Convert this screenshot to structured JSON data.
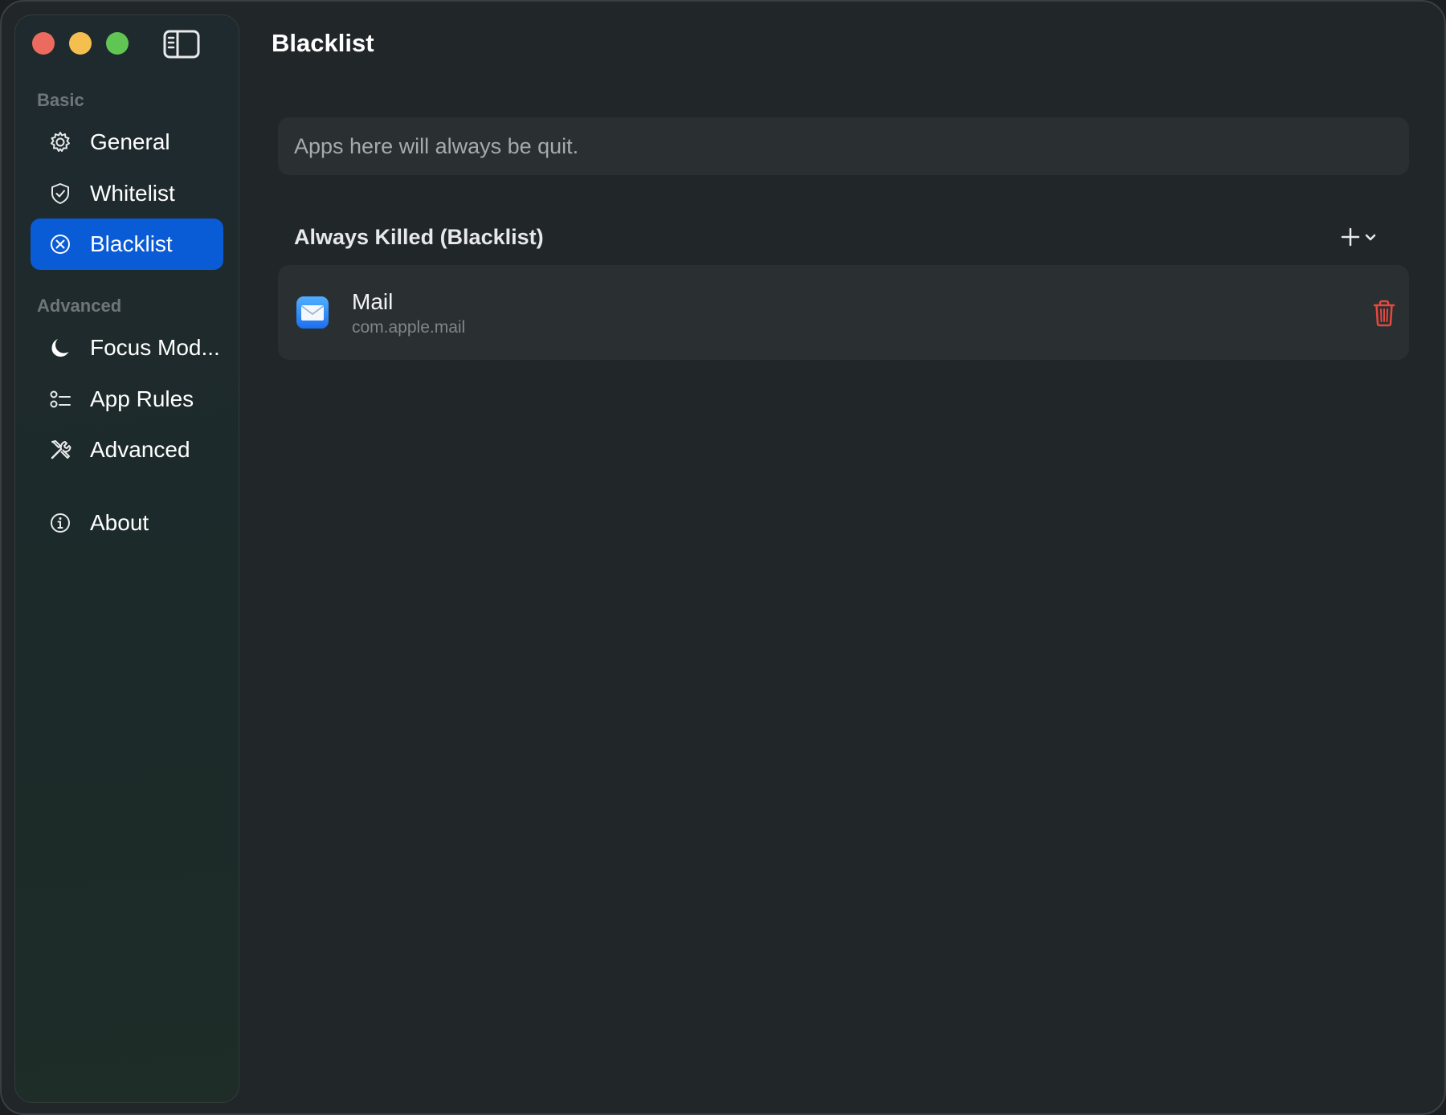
{
  "window": {
    "title": "Blacklist"
  },
  "sidebar": {
    "sections": [
      {
        "label": "Basic",
        "items": [
          {
            "label": "General",
            "icon": "gear-icon"
          },
          {
            "label": "Whitelist",
            "icon": "shield-check-icon"
          },
          {
            "label": "Blacklist",
            "icon": "x-circle-icon",
            "active": true
          }
        ]
      },
      {
        "label": "Advanced",
        "items": [
          {
            "label": "Focus Mod...",
            "icon": "moon-icon"
          },
          {
            "label": "App Rules",
            "icon": "checklist-icon"
          },
          {
            "label": "Advanced",
            "icon": "tools-icon"
          }
        ]
      }
    ],
    "footer_items": [
      {
        "label": "About",
        "icon": "info-circle-icon"
      }
    ]
  },
  "main": {
    "description": "Apps here will always be quit.",
    "section_title": "Always Killed (Blacklist)",
    "apps": [
      {
        "name": "Mail",
        "bundle_id": "com.apple.mail",
        "icon": "mail-app-icon"
      }
    ]
  },
  "colors": {
    "accent": "#0a5bd6",
    "delete": "#e5483f",
    "traffic_red": "#ed6a5e",
    "traffic_yellow": "#f5bf4f",
    "traffic_green": "#61c554"
  }
}
